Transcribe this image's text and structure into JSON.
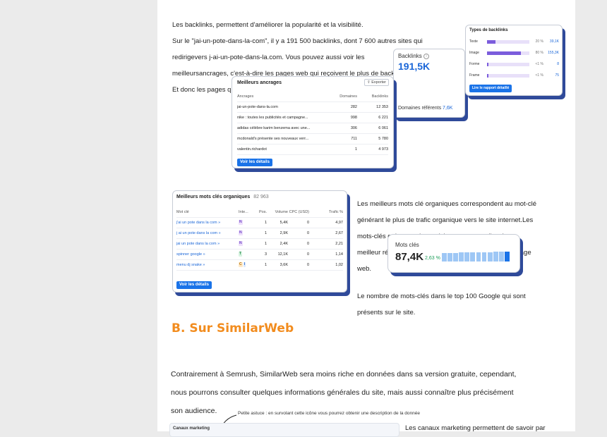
{
  "backlinks_text": {
    "lines": [
      "Les backlinks, permettent d'améliorer la popularité et la visibilité.",
      "Sur le \"jai-un-pote-dans-la-com\", il y a 191 500 backlinks, dont 7 600 autres sites qui",
      "redirigevers j-ai-un-pote-dans-la.com. Vous pouvez aussi voir les",
      "meilleursancrages, c'est-à-dire les pages web qui reçoivent le plus de backlinks.",
      "Et donc les pages qui sont potentiellement les plus populaires."
    ]
  },
  "backlinks_card": {
    "title": "Backlinks",
    "value": "191,5K",
    "ref_label": "Domaines référents",
    "ref_value": "7,6K"
  },
  "types_card": {
    "title": "Types de backlinks",
    "rows": [
      {
        "label": "Texte",
        "fraction": 0.2,
        "pct": "20 %",
        "count": "39,1K"
      },
      {
        "label": "Image",
        "fraction": 0.8,
        "pct": "80 %",
        "count": "155,3K"
      },
      {
        "label": "Forme",
        "fraction": 0.01,
        "pct": "<1 %",
        "count": "8"
      },
      {
        "label": "Frame",
        "fraction": 0.01,
        "pct": "<1 %",
        "count": "75"
      }
    ],
    "button": "Lire le rapport détaillé"
  },
  "anchors_card": {
    "title": "Meilleurs ancrages",
    "export": "Exporter",
    "columns": [
      "Ancrages",
      "Domaines",
      "Backlinks"
    ],
    "rows": [
      [
        "jai-un-pote-dans-la.com",
        "282",
        "12 353"
      ],
      [
        "nike : toutes les publicités et campagne...",
        "998",
        "6 221"
      ],
      [
        "adidas célèbre karim benzema avec une...",
        "306",
        "6 061"
      ],
      [
        "mcdonald's présente ses nouveaux verr...",
        "711",
        "5 780"
      ],
      [
        "valentin.richardot",
        "1",
        "4 973"
      ]
    ],
    "button": "Voir les détails"
  },
  "keywords_card": {
    "title": "Meilleurs mots clés organiques",
    "count": "82 963",
    "columns": [
      "Mot clé",
      "Inte...",
      "Pos.",
      "Volume",
      "CPC (USD)",
      "Trafic %"
    ],
    "rows": [
      {
        "kw": "j'ai un pote dans la com »",
        "intent": [
          "N"
        ],
        "pos": "1",
        "vol": "5,4K",
        "cpc": "0",
        "traffic": "4,97"
      },
      {
        "kw": "j ai un pote dans la com »",
        "intent": [
          "N"
        ],
        "pos": "1",
        "vol": "2,9K",
        "cpc": "0",
        "traffic": "2,67"
      },
      {
        "kw": "jai un pote dans la com »",
        "intent": [
          "N"
        ],
        "pos": "1",
        "vol": "2,4K",
        "cpc": "0",
        "traffic": "2,21"
      },
      {
        "kw": "spinner google »",
        "intent": [
          "T"
        ],
        "pos": "3",
        "vol": "12,1K",
        "cpc": "0",
        "traffic": "1,14"
      },
      {
        "kw": "menu dj snake »",
        "intent": [
          "C",
          "I"
        ],
        "pos": "1",
        "vol": "3,6K",
        "cpc": "0",
        "traffic": "1,02"
      }
    ],
    "button": "Voir les détails"
  },
  "keywords_text": {
    "lines": [
      "Les meilleurs mots clé organiques correspondent au mot-clé",
      "générant le plus de trafic organique vers le site internet.Les",
      "mots-clés qui apparaissent ici, permettrons d'avoir un",
      "meilleur référencement et de rendre plus populaire la page",
      "web."
    ]
  },
  "motscles_card": {
    "title": "Mots clés",
    "value": "87,4K",
    "delta": "2,63 %",
    "trend": [
      0.85,
      0.85,
      0.88,
      0.9,
      0.9,
      0.92,
      0.92,
      0.95,
      0.95,
      0.97,
      0.97,
      1
    ]
  },
  "top100_text": {
    "lines": [
      "Le nombre de mots-clés dans le top 100 Google qui sont",
      "présents sur le site."
    ]
  },
  "section_b": {
    "heading": "B. Sur SimilarWeb",
    "paragraph_lines": [
      "Contrairement à Semrush, SimilarWeb sera moins riche en données dans sa version gratuite, cependant,",
      "nous pourrons consulter quelques informations générales du site, mais aussi connaître plus précisément",
      "son audience."
    ]
  },
  "tip_text": "Petite astuce : en survolant cette icône vous pourrez obtenir une description de la donnée",
  "canaux_label": "Canaux marketing",
  "canaux_text": "Les canaux marketing permettent de savoir par",
  "colors": {
    "accent": "#1a73e8",
    "shadow": "#2f4a9a",
    "heading": "#f28c1e",
    "bar": "#7b5cdc"
  }
}
